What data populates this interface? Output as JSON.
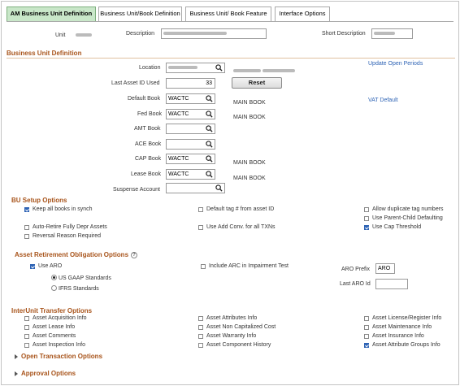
{
  "tabs": [
    {
      "label": "AM Business Unit Definition",
      "active": true
    },
    {
      "label": "Business Unit/Book Definition",
      "active": false
    },
    {
      "label": "Business Unit/ Book Feature",
      "active": false
    },
    {
      "label": "Interface Options",
      "active": false
    }
  ],
  "header": {
    "unit_label": "Unit",
    "description_label": "Description",
    "short_description_label": "Short Description"
  },
  "bu_definition": {
    "title": "Business Unit Definition",
    "location_label": "Location",
    "last_asset_id_label": "Last Asset ID Used",
    "last_asset_id_value": "33",
    "reset_label": "Reset",
    "update_open_periods": "Update Open Periods",
    "vat_default": "VAT Default",
    "default_book_label": "Default Book",
    "default_book_value": "WACTC",
    "default_book_desc": "MAIN BOOK",
    "fed_book_label": "Fed Book",
    "fed_book_value": "WACTC",
    "fed_book_desc": "MAIN BOOK",
    "amt_book_label": "AMT Book",
    "ace_book_label": "ACE Book",
    "cap_book_label": "CAP Book",
    "cap_book_value": "WACTC",
    "cap_book_desc": "MAIN BOOK",
    "lease_book_label": "Lease Book",
    "lease_book_value": "WACTC",
    "lease_book_desc": "MAIN BOOK",
    "suspense_account_label": "Suspense Account"
  },
  "bu_setup": {
    "title": "BU Setup Options",
    "keep_all_books": {
      "label": "Keep all books in synch",
      "checked": true
    },
    "default_tag": {
      "label": "Default tag # from asset ID",
      "checked": false
    },
    "allow_duplicate": {
      "label": "Allow duplicate tag numbers",
      "checked": false
    },
    "use_parent_child": {
      "label": "Use Parent-Child Defaulting",
      "checked": false
    },
    "auto_retire": {
      "label": "Auto-Retire Fully Depr Assets",
      "checked": false
    },
    "use_add_conv": {
      "label": "Use Add Conv. for all TXNs",
      "checked": false
    },
    "use_cap_threshold": {
      "label": "Use Cap Threshold",
      "checked": true
    },
    "reversal_reason": {
      "label": "Reversal Reason Required",
      "checked": false
    }
  },
  "aro": {
    "title": "Asset Retirement Obligation Options",
    "help_icon": "?",
    "use_aro": {
      "label": "Use ARO",
      "checked": true
    },
    "include_arc": {
      "label": "Include ARC in Impairment Test",
      "checked": false
    },
    "us_gaap": {
      "label": "US GAAP Standards",
      "selected": true
    },
    "ifrs": {
      "label": "IFRS Standards",
      "selected": false
    },
    "aro_prefix_label": "ARO Prefix",
    "aro_prefix_value": "ARO",
    "last_aro_id_label": "Last ARO Id"
  },
  "interunit": {
    "title": "InterUnit Transfer Options",
    "items": [
      {
        "label": "Asset Acquisition Info",
        "checked": false
      },
      {
        "label": "Asset Attributes Info",
        "checked": false
      },
      {
        "label": "Asset License/Register Info",
        "checked": false
      },
      {
        "label": "Asset Lease Info",
        "checked": false
      },
      {
        "label": "Asset Non Capitalized Cost",
        "checked": false
      },
      {
        "label": "Asset Maintenance Info",
        "checked": false
      },
      {
        "label": "Asset Comments",
        "checked": false
      },
      {
        "label": "Asset Warranty Info",
        "checked": false
      },
      {
        "label": "Asset Insurance Info",
        "checked": false
      },
      {
        "label": "Asset Inspection Info",
        "checked": false
      },
      {
        "label": "Asset Component History",
        "checked": false
      },
      {
        "label": "Asset Attribute Groups Info",
        "checked": true
      }
    ]
  },
  "collapsibles": {
    "open_transaction": "Open Transaction Options",
    "approval": "Approval Options"
  },
  "colors": {
    "section_title": "#a8541b",
    "active_tab": "#c9e7c9",
    "link": "#2f64b5"
  }
}
